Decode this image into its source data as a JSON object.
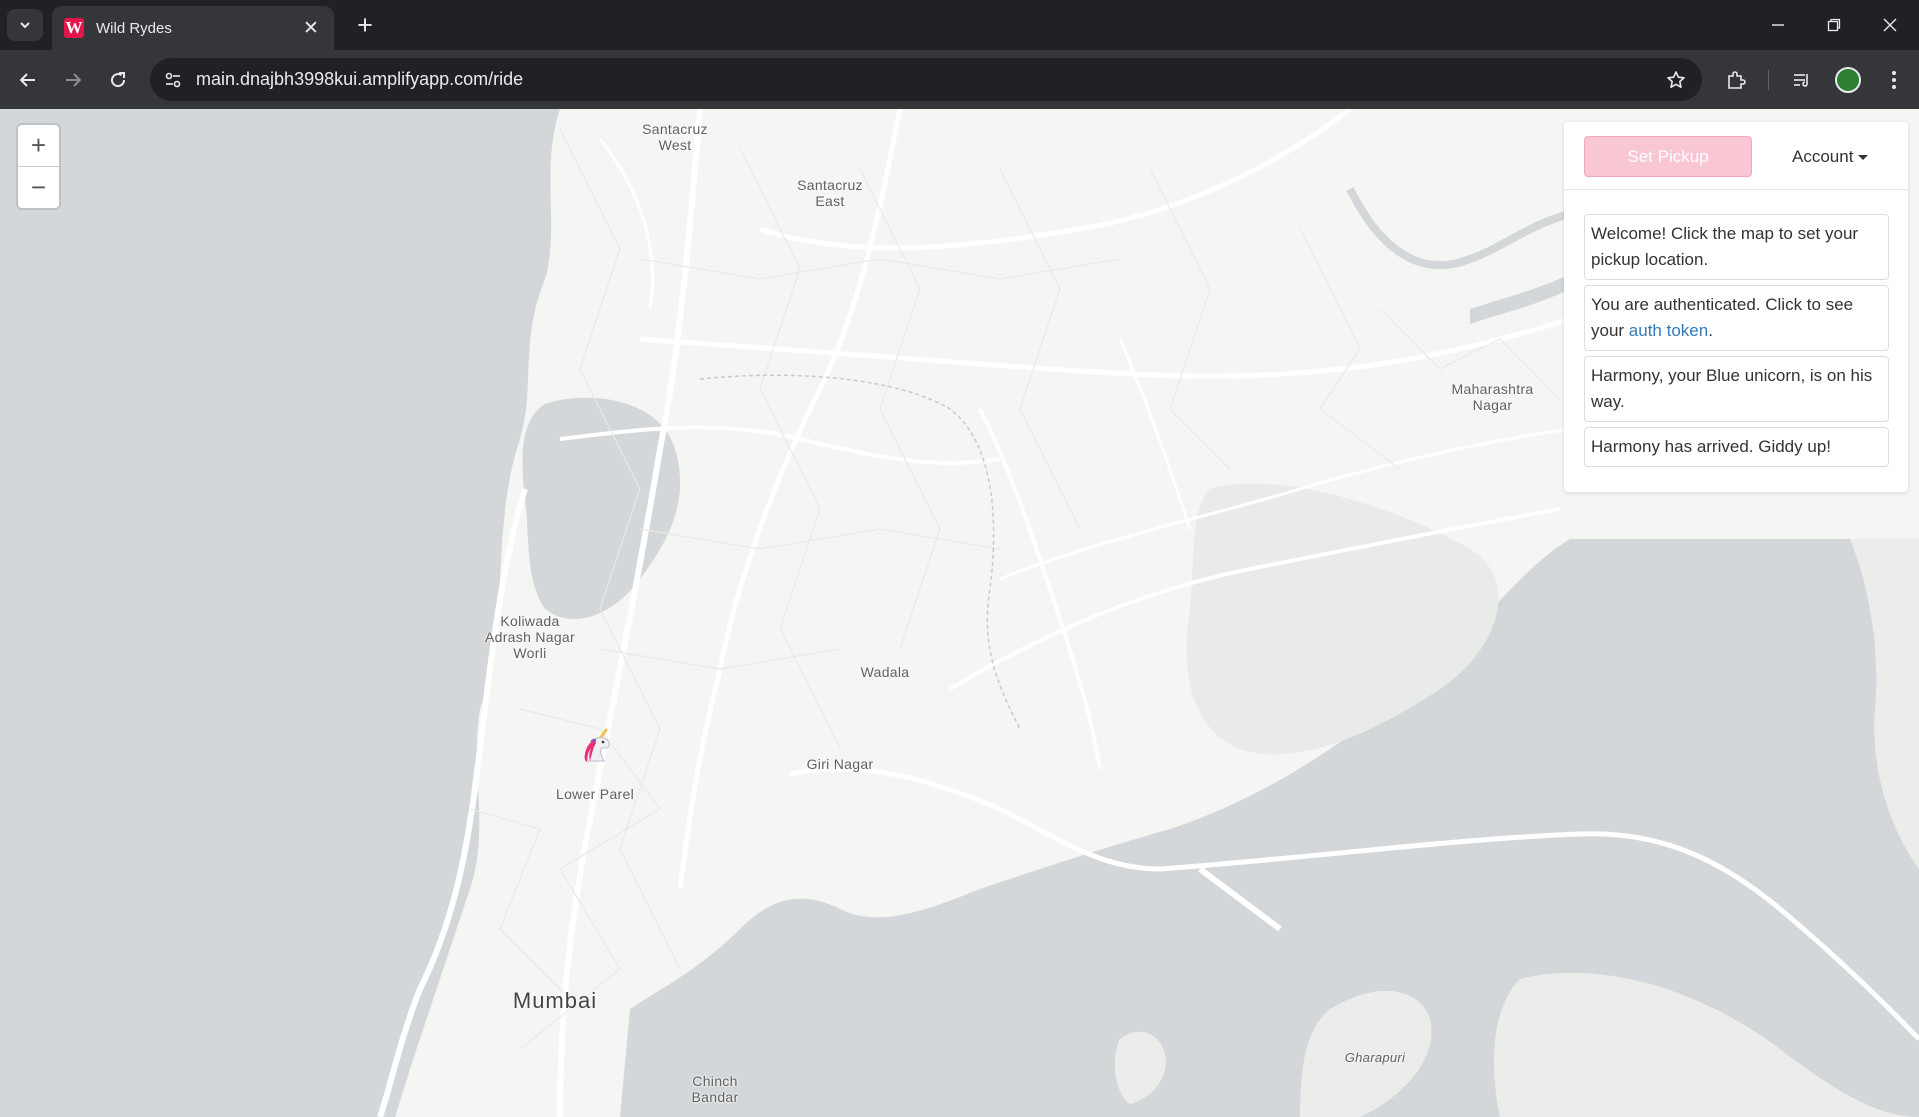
{
  "browser": {
    "tab_title": "Wild Rydes",
    "favicon_letter": "W",
    "url": "main.dnajbh3998kui.amplifyapp.com/ride"
  },
  "map": {
    "labels": {
      "santacruz_west": "Santacruz West",
      "santacruz_east": "Santacruz East",
      "maharashtra_nagar": "Maharashtra Nagar",
      "koliwada": "Koliwada Adrash Nagar Worli",
      "wadala": "Wadala",
      "giri_nagar": "Giri Nagar",
      "lower_parel": "Lower Parel",
      "mumbai": "Mumbai",
      "chinch_bandar": "Chinch Bandar",
      "gharapuri": "Gharapuri"
    },
    "zoom_in": "+",
    "zoom_out": "−",
    "marker_icon": "unicorn-icon"
  },
  "panel": {
    "set_pickup_label": "Set Pickup",
    "account_label": "Account",
    "messages": {
      "welcome": "Welcome! Click the map to set your pickup location.",
      "auth_prefix": "You are authenticated. Click to see your ",
      "auth_link": "auth token",
      "auth_suffix": ".",
      "on_way": "Harmony, your Blue unicorn, is on his way.",
      "arrived": "Harmony has arrived. Giddy up!"
    }
  },
  "colors": {
    "accent": "#f9c6d3",
    "link": "#337ab7",
    "water": "#d4d7d9",
    "land": "#f5f5f3"
  }
}
